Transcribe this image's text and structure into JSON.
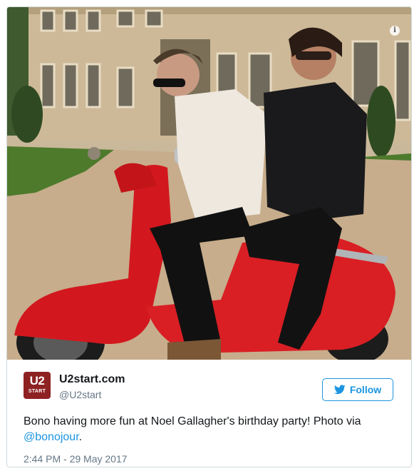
{
  "tweet": {
    "author": {
      "display_name": "U2start.com",
      "handle": "@U2start",
      "avatar_text_top": "U2",
      "avatar_text_bottom": "START"
    },
    "follow_label": "Follow",
    "text_main": "Bono having more fun at Noel Gallagher's birthday party! Photo via ",
    "mention": "@bonojour",
    "text_end": ".",
    "timestamp": "2:44 PM - 29 May 2017",
    "photo_info_icon": "info-icon",
    "follow_icon": "twitter-bird-icon"
  },
  "colors": {
    "accent": "#1b95e0",
    "avatar_bg": "#8e2223",
    "muted": "#657786",
    "text": "#14171a"
  }
}
